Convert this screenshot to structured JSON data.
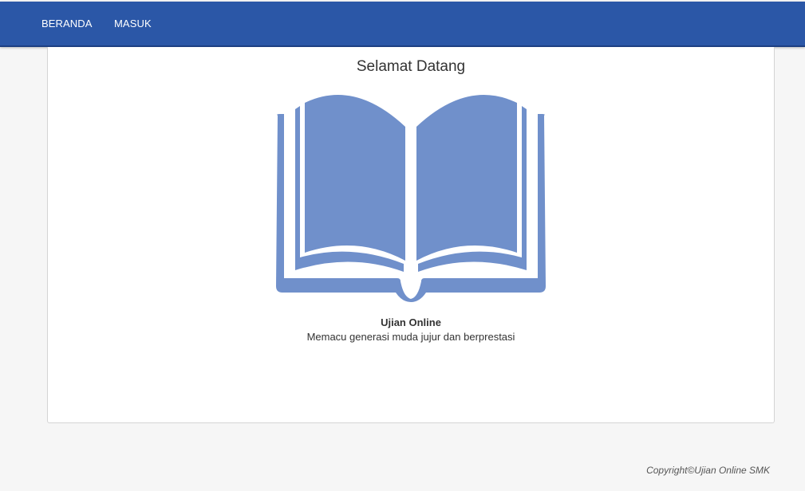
{
  "navbar": {
    "items": [
      {
        "label": "BERANDA"
      },
      {
        "label": "MASUK"
      }
    ],
    "background_color": "#2b57a7"
  },
  "main": {
    "title": "Selamat Datang",
    "icon": "open-book-icon",
    "icon_color": "#7090cb",
    "app_name": "Ujian Online",
    "tagline": "Memacu generasi muda jujur dan berprestasi"
  },
  "footer": {
    "copyright": "Copyright©Ujian Online SMK"
  }
}
